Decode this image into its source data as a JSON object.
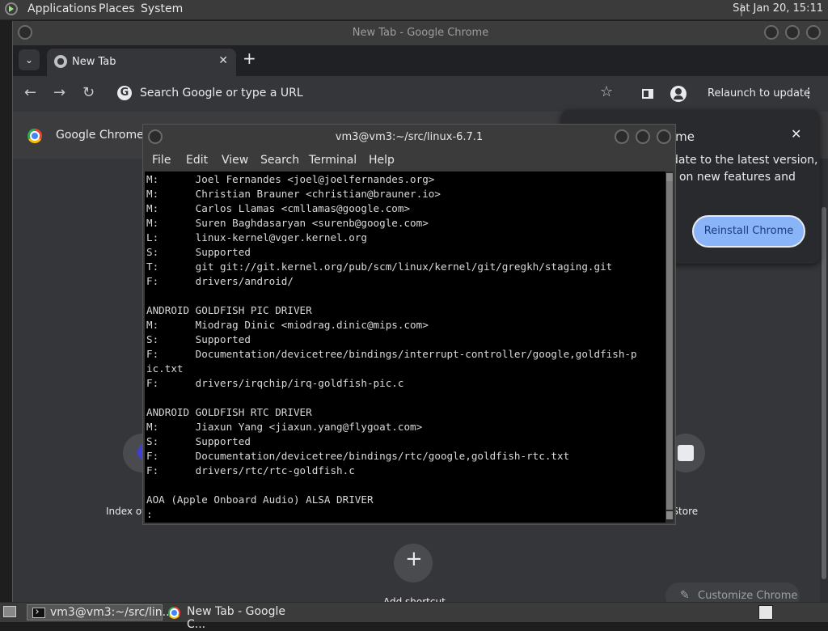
{
  "top_panel": {
    "menus": [
      "Applications",
      "Places",
      "System"
    ],
    "clock": "Sat Jan 20, 15:11"
  },
  "chrome": {
    "window_title": "New Tab - Google Chrome",
    "tab": {
      "title": "New Tab",
      "close": "✕"
    },
    "new_tab": "+",
    "tab_dropdown": "⌄",
    "omnibox_placeholder": "Search Google or type a URL",
    "relaunch_label": "Relaunch to update",
    "menu_glyph": "⋮",
    "bookmark_glyph": "☆",
    "back_glyph": "←",
    "forward_glyph": "→",
    "reload_glyph": "↻",
    "infobar_text": "Google Chrome is",
    "update_bubble": {
      "title_fragment": "ome",
      "body_line1": "date to the latest version,",
      "body_line2": "t on new features and",
      "button": "Reinstall Chrome",
      "close": "✕"
    },
    "shortcuts": {
      "left_label": "Index of",
      "right_label": "b Store",
      "add_label": "Add shortcut",
      "add_glyph": "+",
      "left_initial": "C"
    },
    "customize_label": "Customize Chrome",
    "customize_glyph": "✎"
  },
  "terminal": {
    "title": "vm3@vm3:~/src/linux-6.7.1",
    "menu": [
      "File",
      "Edit",
      "View",
      "Search",
      "Terminal",
      "Help"
    ],
    "lines": [
      "M:      Joel Fernandes <joel@joelfernandes.org>",
      "M:      Christian Brauner <christian@brauner.io>",
      "M:      Carlos Llamas <cmllamas@google.com>",
      "M:      Suren Baghdasaryan <surenb@google.com>",
      "L:      linux-kernel@vger.kernel.org",
      "S:      Supported",
      "T:      git git://git.kernel.org/pub/scm/linux/kernel/git/gregkh/staging.git",
      "F:      drivers/android/",
      "",
      "ANDROID GOLDFISH PIC DRIVER",
      "M:      Miodrag Dinic <miodrag.dinic@mips.com>",
      "S:      Supported",
      "F:      Documentation/devicetree/bindings/interrupt-controller/google,goldfish-p",
      "ic.txt",
      "F:      drivers/irqchip/irq-goldfish-pic.c",
      "",
      "ANDROID GOLDFISH RTC DRIVER",
      "M:      Jiaxun Yang <jiaxun.yang@flygoat.com>",
      "S:      Supported",
      "F:      Documentation/devicetree/bindings/rtc/google,goldfish-rtc.txt",
      "F:      drivers/rtc/rtc-goldfish.c",
      "",
      "AOA (Apple Onboard Audio) ALSA DRIVER",
      ":"
    ]
  },
  "taskbar": {
    "items": [
      {
        "label": "vm3@vm3:~/src/lin..."
      },
      {
        "label": "New Tab - Google C..."
      }
    ]
  }
}
